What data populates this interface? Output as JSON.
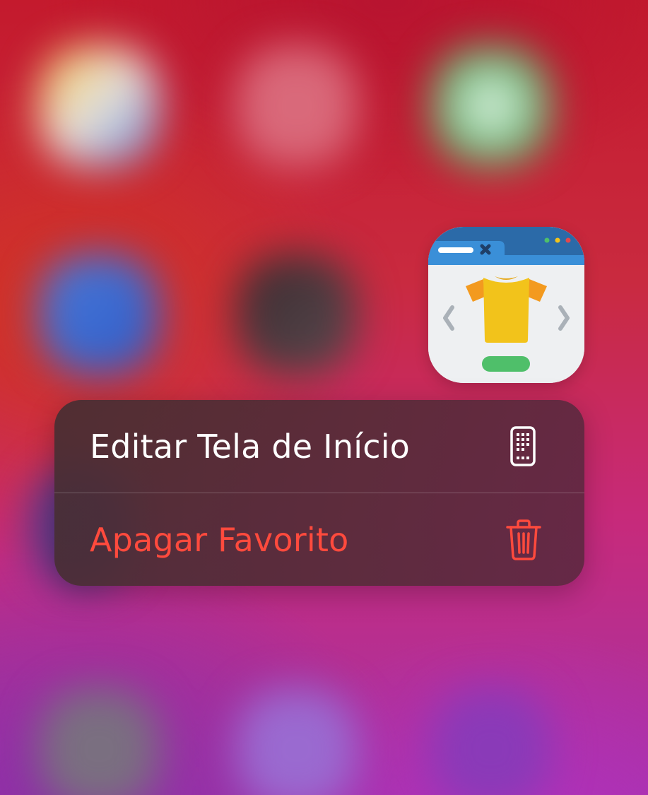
{
  "home_screen": {
    "app": {
      "icon": "tshirt-shop-icon"
    }
  },
  "context_menu": {
    "items": [
      {
        "label": "Editar Tela de Início",
        "icon": "phone-apps-icon",
        "color": "#ffffff"
      },
      {
        "label": "Apagar Favorito",
        "icon": "trash-icon",
        "color": "#ff4a3d"
      }
    ]
  },
  "colors": {
    "destructive": "#ff4a3d",
    "menu_text": "#ffffff",
    "icon_blue": "#3a8fd8",
    "shirt_yellow": "#f2c31b",
    "sleeve_orange": "#f39a1f",
    "button_green": "#4fbf6a"
  }
}
